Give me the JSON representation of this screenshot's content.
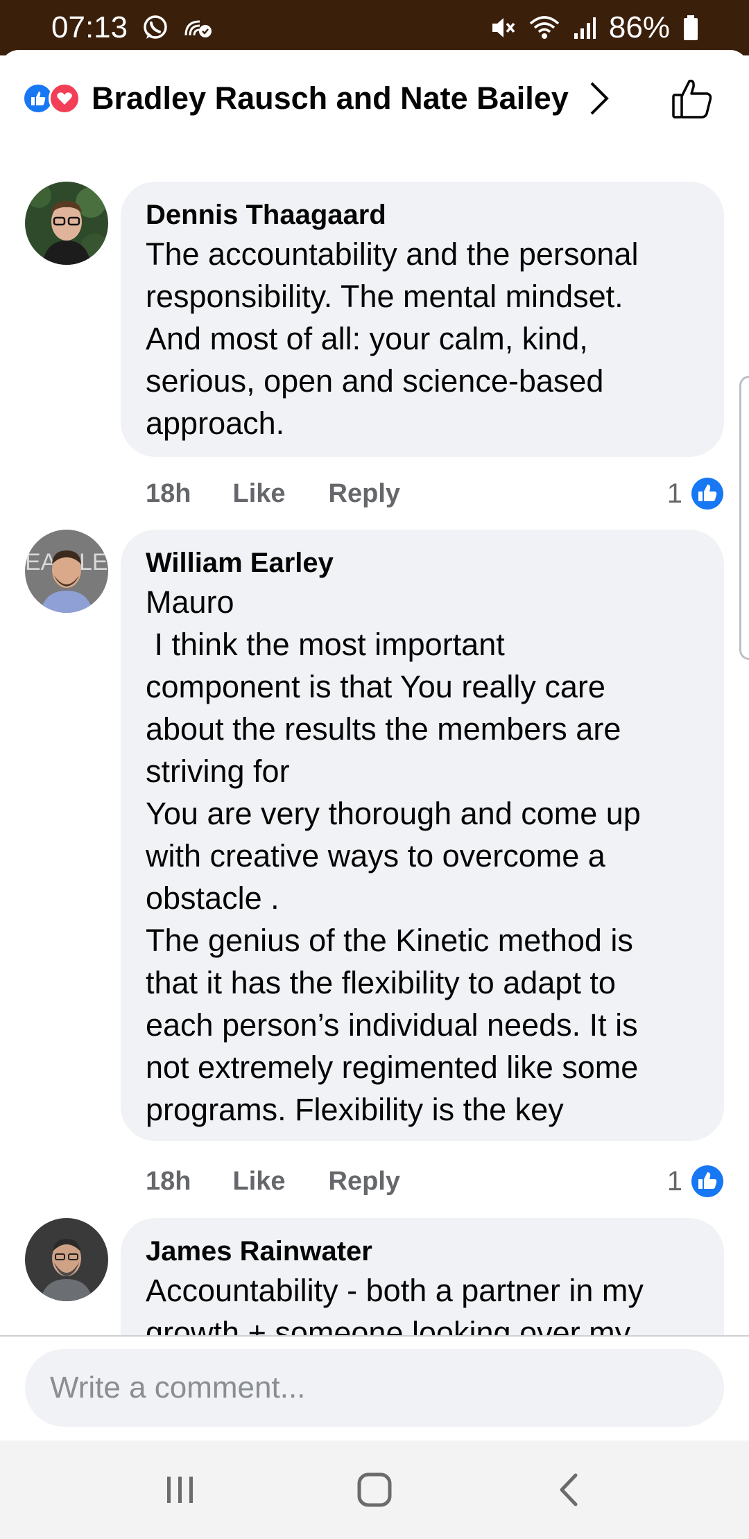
{
  "status_bar": {
    "time": "07:13",
    "battery": "86%",
    "icons": [
      "whatsapp-icon",
      "nfc-icon",
      "mute-icon",
      "wifi-icon",
      "signal-icon",
      "battery-icon"
    ]
  },
  "header": {
    "title": "Bradley Rausch and Nate Bailey",
    "reaction_icons": [
      "like-reaction-icon",
      "love-reaction-icon"
    ],
    "accent_color": "#1877f2",
    "love_color": "#f33e58"
  },
  "comments": [
    {
      "author": "Dennis Thaagaard",
      "text": "The accountability and the personal\nresponsibility. The mental mindset.\nAnd most of all: your calm, kind,\nserious, open and science-based\napproach.",
      "time": "18h",
      "like_label": "Like",
      "reply_label": "Reply",
      "reaction_count": "1"
    },
    {
      "author": "William Earley",
      "text": "Mauro\n I think the most important\ncomponent is that You really care\nabout the results the members are\nstriving for\nYou are very thorough and come up\nwith creative ways to overcome a\nobstacle .\nThe genius of the Kinetic method is\nthat it has the flexibility to adapt to\neach person’s individual needs. It is\nnot extremely regimented like some\nprograms. Flexibility is the key",
      "time": "18h",
      "like_label": "Like",
      "reply_label": "Reply",
      "reaction_count": "1"
    },
    {
      "author": "James Rainwater",
      "text": "Accountability - both a partner in my\ngrowth + someone looking over my"
    }
  ],
  "composer": {
    "placeholder": "Write a comment..."
  },
  "navbar": {
    "icons": [
      "recent-apps-icon",
      "home-icon",
      "back-icon"
    ]
  }
}
